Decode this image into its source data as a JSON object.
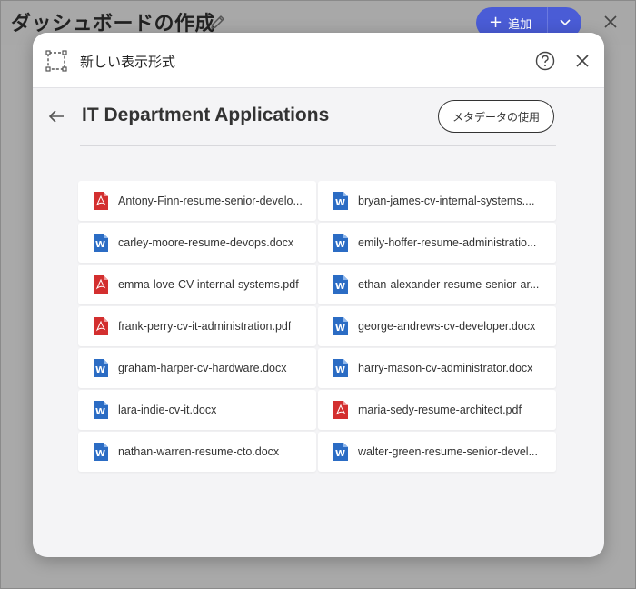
{
  "app": {
    "title": "ダッシュボードの作成",
    "add_label": "追加"
  },
  "modal": {
    "title": "新しい表示形式",
    "folder_title": "IT Department Applications",
    "metadata_button": "メタデータの使用"
  },
  "files": [
    {
      "name": "Antony-Finn-resume-senior-develo...",
      "type": "pdf"
    },
    {
      "name": "bryan-james-cv-internal-systems....",
      "type": "word"
    },
    {
      "name": "carley-moore-resume-devops.docx",
      "type": "word"
    },
    {
      "name": "emily-hoffer-resume-administratio...",
      "type": "word"
    },
    {
      "name": "emma-love-CV-internal-systems.pdf",
      "type": "pdf"
    },
    {
      "name": "ethan-alexander-resume-senior-ar...",
      "type": "word"
    },
    {
      "name": "frank-perry-cv-it-administration.pdf",
      "type": "pdf"
    },
    {
      "name": "george-andrews-cv-developer.docx",
      "type": "word"
    },
    {
      "name": "graham-harper-cv-hardware.docx",
      "type": "word"
    },
    {
      "name": "harry-mason-cv-administrator.docx",
      "type": "word"
    },
    {
      "name": "lara-indie-cv-it.docx",
      "type": "word"
    },
    {
      "name": "maria-sedy-resume-architect.pdf",
      "type": "pdf"
    },
    {
      "name": "nathan-warren-resume-cto.docx",
      "type": "word"
    },
    {
      "name": "walter-green-resume-senior-devel...",
      "type": "word"
    }
  ],
  "colors": {
    "accent": "#4a5cd6",
    "pdf_red": "#d32f2f",
    "word_blue": "#2b6cc4"
  },
  "icons": {
    "pencil": "pencil-icon",
    "add": "plus-icon",
    "chevron": "chevron-down-icon",
    "close": "close-icon",
    "visualization": "visualization-icon",
    "help": "help-icon",
    "back": "back-arrow-icon",
    "pdf": "pdf-file-icon",
    "word": "word-file-icon"
  }
}
